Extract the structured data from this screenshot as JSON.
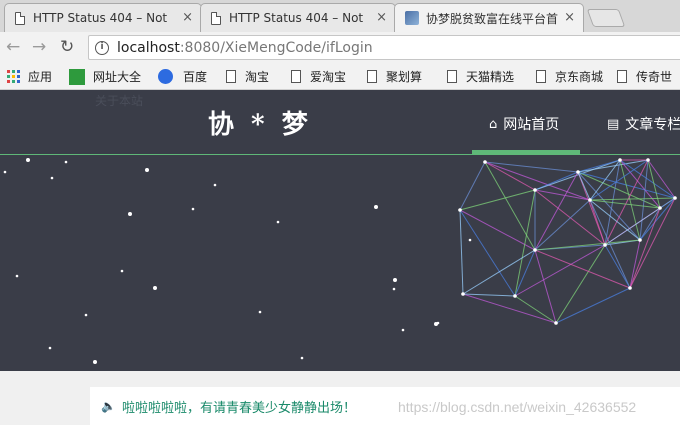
{
  "browser": {
    "tabs": [
      {
        "title": "HTTP Status 404 – Not",
        "close": "×"
      },
      {
        "title": "HTTP Status 404 – Not",
        "close": "×"
      },
      {
        "title": "协梦脱贫致富在线平台首",
        "close": "×"
      }
    ],
    "nav": {
      "back": "←",
      "forward": "→",
      "reload": "↻"
    },
    "url": {
      "host": "localhost",
      "rest": ":8080/XieMengCode/ifLogin"
    },
    "bookmarks": [
      "应用",
      "网址大全",
      "百度",
      "淘宝",
      "爱淘宝",
      "聚划算",
      "天猫精选",
      "京东商城",
      "传奇世"
    ]
  },
  "site": {
    "ghost_text": "关于本站",
    "logo": "协 * 梦",
    "nav": [
      {
        "label": "网站首页",
        "icon": "home-icon",
        "glyph": "⌂"
      },
      {
        "label": "文章专栏",
        "icon": "document-icon",
        "glyph": "▤"
      }
    ],
    "accent": "#5fb878",
    "hero_bg": "#3a3d48"
  },
  "notice": {
    "speaker": "🔈",
    "text": "啦啦啦啦啦，有请青春美少女静静出场！"
  },
  "watermark": "https://blog.csdn.net/weixin_42636552"
}
